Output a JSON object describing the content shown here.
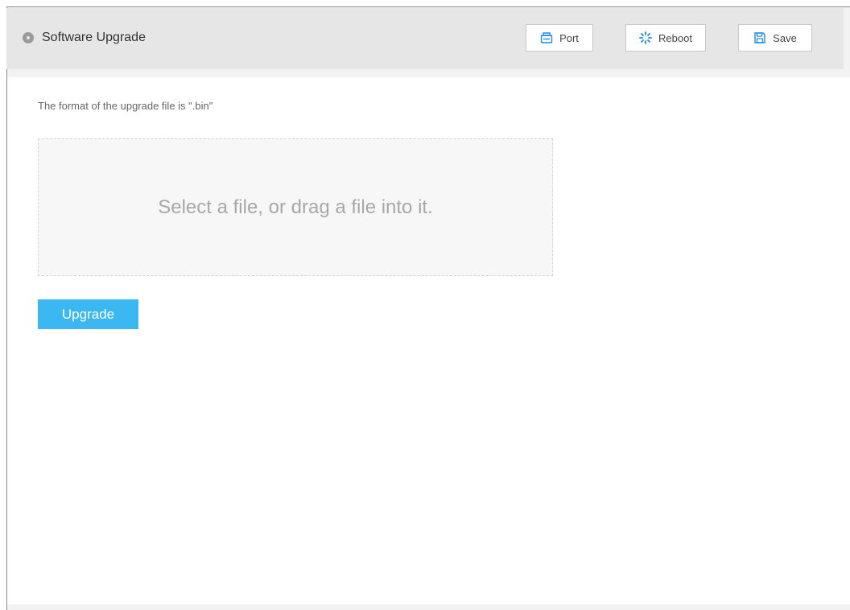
{
  "header": {
    "title": "Software Upgrade",
    "title_icon": "location-pin-icon",
    "buttons": {
      "port": {
        "label": "Port",
        "icon": "port-icon"
      },
      "reboot": {
        "label": "Reboot",
        "icon": "reboot-icon"
      },
      "save": {
        "label": "Save",
        "icon": "save-icon"
      }
    }
  },
  "main": {
    "hint": "The format of the upgrade file is \".bin\"",
    "dropzone_text": "Select a file, or drag a file into it.",
    "upgrade_label": "Upgrade"
  },
  "colors": {
    "header_bg": "#e6e6e6",
    "accent": "#3bb8f2",
    "icon_blue": "#1e88e5"
  }
}
